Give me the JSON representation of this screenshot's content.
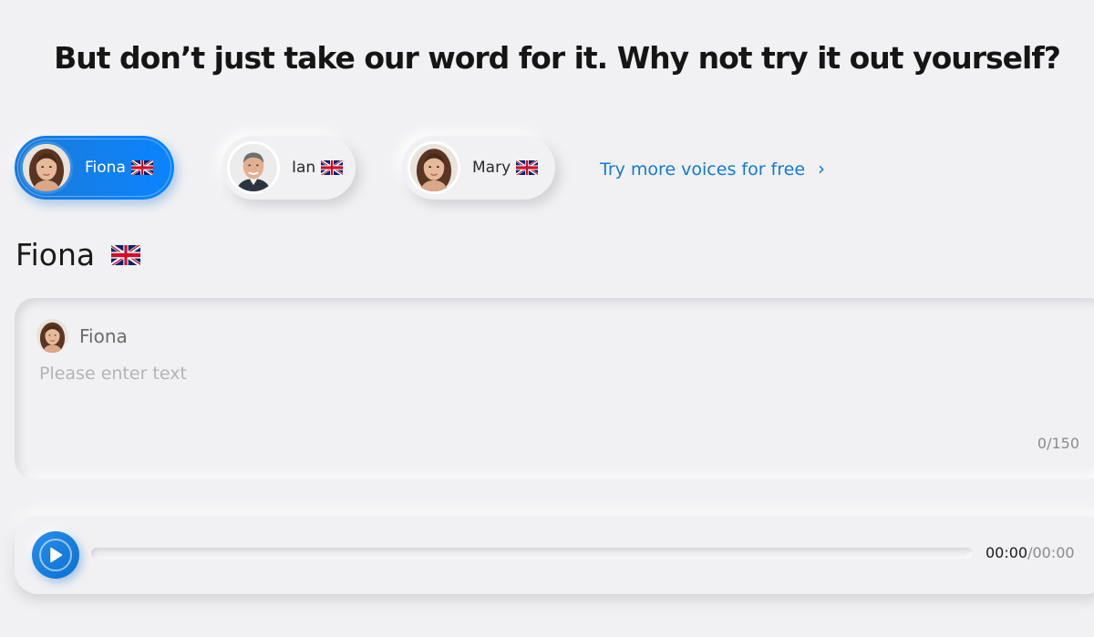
{
  "headline": "But don’t just take our word for it. Why not try it out yourself?",
  "voices": [
    {
      "name": "Fiona",
      "flag": "uk-flag",
      "selected": true
    },
    {
      "name": "Ian",
      "flag": "uk-flag",
      "selected": false
    },
    {
      "name": "Mary",
      "flag": "uk-flag",
      "selected": false
    }
  ],
  "more_voices": {
    "label": "Try more voices for free",
    "icon": "chevron-right-icon"
  },
  "selected_voice": {
    "name": "Fiona",
    "flag": "uk-flag"
  },
  "text_card": {
    "speaker_name": "Fiona",
    "placeholder": "Please enter text",
    "value": "",
    "char_count": "0/150"
  },
  "player": {
    "current_time": "00:00",
    "total_time": "/00:00",
    "progress": 0
  },
  "colors": {
    "accent": "#0a84ff",
    "link": "#1778d2",
    "background": "#f1f1f3"
  }
}
